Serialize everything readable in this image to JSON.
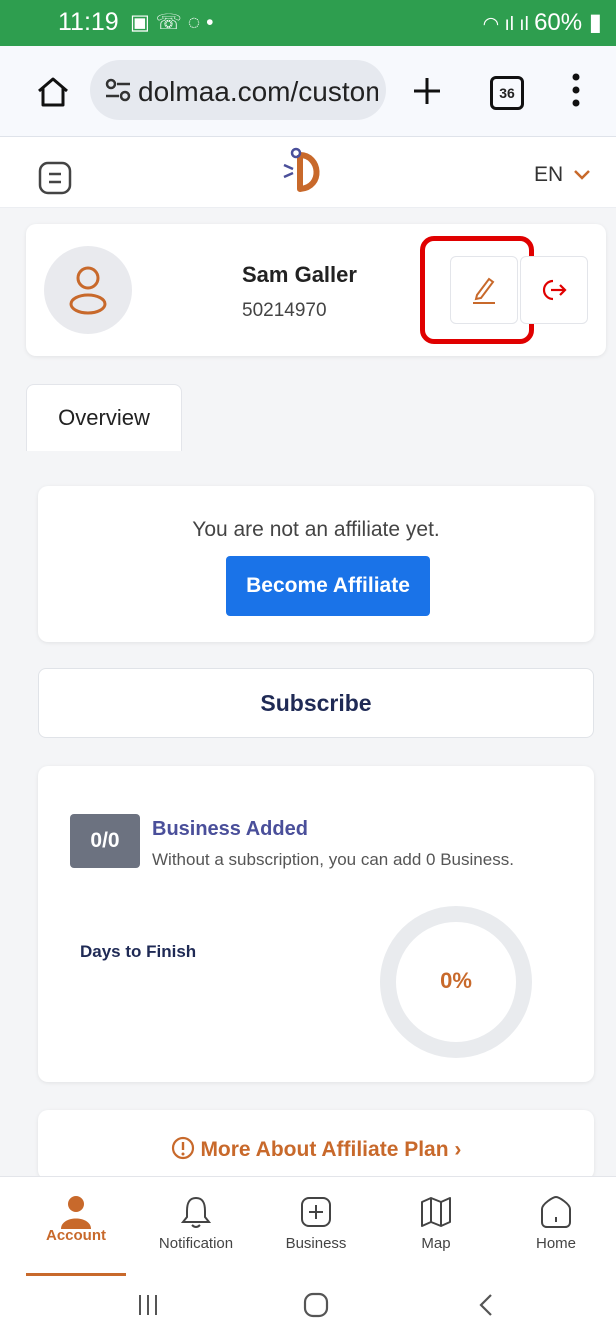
{
  "status_bar": {
    "time": "11:19",
    "battery": "60%"
  },
  "browser": {
    "url": "dolmaa.com/custom",
    "tab_count": "36"
  },
  "header": {
    "language": "EN"
  },
  "profile": {
    "name": "Sam Galler",
    "id": "50214970"
  },
  "tabs": [
    {
      "label": "Overview"
    }
  ],
  "affiliate": {
    "message": "You are not an affiliate yet.",
    "button": "Become Affiliate"
  },
  "subscribe": {
    "label": "Subscribe"
  },
  "business": {
    "count": "0/0",
    "title": "Business Added",
    "subtitle": "Without a subscription, you can add 0 Business.",
    "days_label": "Days to Finish",
    "progress_label": "0%",
    "progress": 0
  },
  "more_link": {
    "label": "More About Affiliate Plan"
  },
  "bottom_nav": [
    {
      "label": "Account",
      "icon": "user-icon",
      "active": true
    },
    {
      "label": "Notification",
      "icon": "bell-icon",
      "active": false
    },
    {
      "label": "Business",
      "icon": "plus-square-icon",
      "active": false
    },
    {
      "label": "Map",
      "icon": "map-icon",
      "active": false
    },
    {
      "label": "Home",
      "icon": "home-icon",
      "active": false
    }
  ],
  "colors": {
    "accent": "#c8692b",
    "primary": "#1a73e8",
    "status_bar": "#2e9e4f",
    "highlight": "#e00000",
    "navy": "#1f2a55",
    "purple": "#4a4f9a"
  }
}
